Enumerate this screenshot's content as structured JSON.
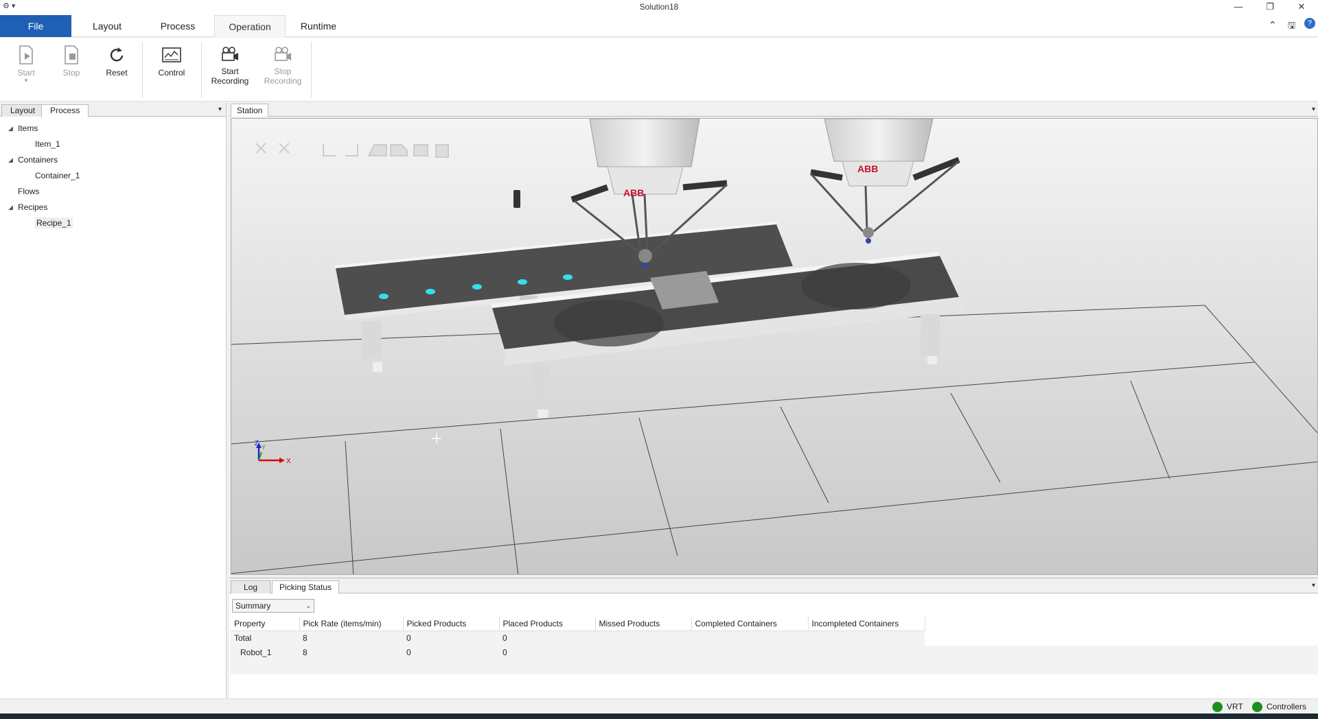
{
  "window": {
    "title": "Solution18",
    "minimize": "—",
    "restore": "❐",
    "close": "✕",
    "quick_access": "⚙ ▾"
  },
  "ribbon_tabs": [
    "File",
    "Layout",
    "Process",
    "Operation",
    "Runtime"
  ],
  "ribbon_active_tab": "Operation",
  "ribbon_right": {
    "collapse": "⌃",
    "save": "🖫",
    "help": "?"
  },
  "ribbon": {
    "start": "Start",
    "start_dropdown": "▾",
    "stop": "Stop",
    "reset": "Reset",
    "control": "Control",
    "start_recording_1": "Start",
    "start_recording_2": "Recording",
    "stop_recording_1": "Stop",
    "stop_recording_2": "Recording"
  },
  "left_panel": {
    "tabs": [
      "Layout",
      "Process"
    ],
    "active_tab": "Process",
    "tree": [
      {
        "label": "Items",
        "level": 0,
        "expanded": true
      },
      {
        "label": "Item_1",
        "level": 1
      },
      {
        "label": "Containers",
        "level": 0,
        "expanded": true
      },
      {
        "label": "Container_1",
        "level": 1
      },
      {
        "label": "Flows",
        "level": 0
      },
      {
        "label": "Recipes",
        "level": 0,
        "expanded": true
      },
      {
        "label": "Recipe_1",
        "level": 1,
        "selected": true
      }
    ]
  },
  "station": {
    "tab": "Station",
    "robot_logo": "ABB",
    "axis_x": "X",
    "axis_y": "Y",
    "axis_z": "Z"
  },
  "bottom_panel": {
    "tabs": [
      "Log",
      "Picking Status"
    ],
    "active_tab": "Picking Status",
    "view_select": "Summary",
    "columns": [
      "Property",
      "Pick Rate (items/min)",
      "Picked Products",
      "Placed Products",
      "Missed Products",
      "Completed Containers",
      "Incompleted Containers"
    ],
    "rows": [
      {
        "property": "Total",
        "pick_rate": "8",
        "picked": "0",
        "placed": "0"
      },
      {
        "property": "Robot_1",
        "pick_rate": "8",
        "picked": "0",
        "placed": "0"
      }
    ]
  },
  "status_bar": {
    "vrt": "VRT",
    "controllers": "Controllers",
    "indicator_color": "#1e8f1e"
  },
  "colors": {
    "file_tab": "#1f5fb4",
    "item_dot": "#33e0f0",
    "conveyor_belt": "#4a4a4a"
  }
}
